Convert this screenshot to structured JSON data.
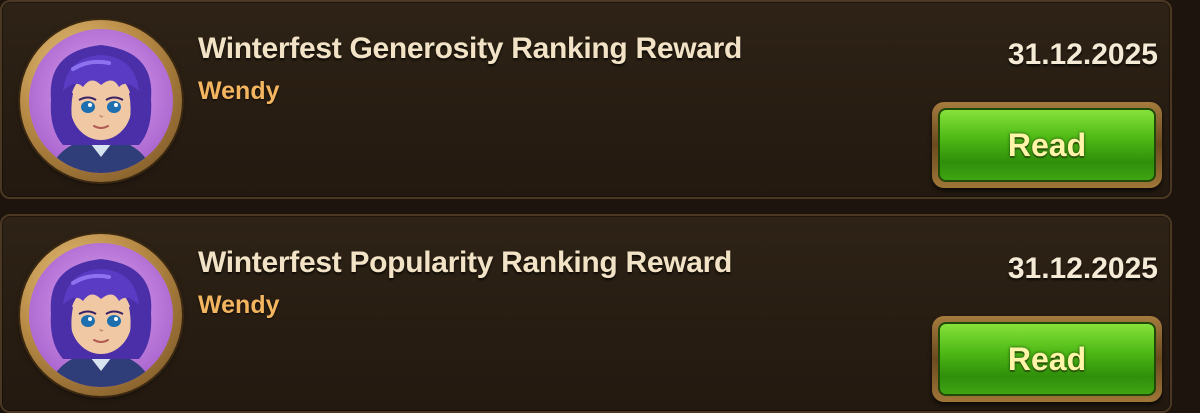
{
  "mail_list": {
    "items": [
      {
        "title": "Winterfest Generosity Ranking Reward",
        "sender": "Wendy",
        "date": "31.12.2025",
        "read_label": "Read"
      },
      {
        "title": "Winterfest Popularity Ranking Reward",
        "sender": "Wendy",
        "date": "31.12.2025",
        "read_label": "Read"
      }
    ]
  },
  "colors": {
    "panel_bg": "#2a1f14",
    "panel_border": "#4a3823",
    "title_text": "#f2e3c6",
    "sender_text": "#f4b560",
    "button_green": "#4fb916",
    "button_label": "#fff4a8",
    "avatar_frame": "#b78a45",
    "avatar_bg": "#c57fe0"
  },
  "icons": {
    "avatar": "wendy-portrait-icon"
  }
}
